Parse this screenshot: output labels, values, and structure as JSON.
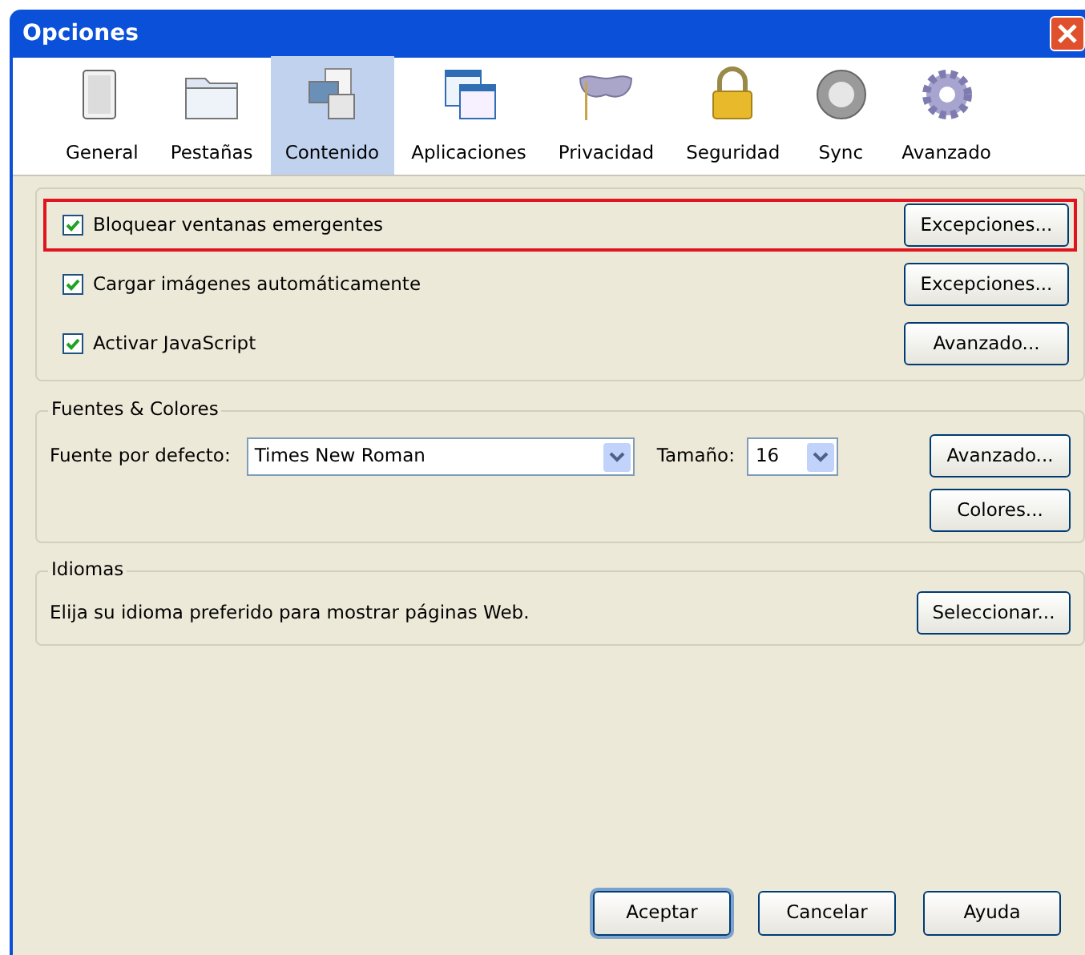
{
  "window": {
    "title": "Opciones"
  },
  "tabs": [
    {
      "label": "General",
      "selected": false,
      "kind": "general"
    },
    {
      "label": "Pestañas",
      "selected": false,
      "kind": "tabs"
    },
    {
      "label": "Contenido",
      "selected": true,
      "kind": "content"
    },
    {
      "label": "Aplicaciones",
      "selected": false,
      "kind": "apps"
    },
    {
      "label": "Privacidad",
      "selected": false,
      "kind": "privacy"
    },
    {
      "label": "Seguridad",
      "selected": false,
      "kind": "security"
    },
    {
      "label": "Sync",
      "selected": false,
      "kind": "sync"
    },
    {
      "label": "Avanzado",
      "selected": false,
      "kind": "advanced"
    }
  ],
  "content_options": [
    {
      "label": "Bloquear ventanas emergentes",
      "checked": true,
      "highlighted": true,
      "button": "Excepciones..."
    },
    {
      "label": "Cargar imágenes automáticamente",
      "checked": true,
      "highlighted": false,
      "button": "Excepciones..."
    },
    {
      "label": "Activar JavaScript",
      "checked": true,
      "highlighted": false,
      "button": "Avanzado..."
    }
  ],
  "fonts_colors": {
    "title": "Fuentes & Colores",
    "font_label": "Fuente por defecto:",
    "font_value": "Times New Roman",
    "size_label": "Tamaño:",
    "size_value": "16",
    "advanced_button": "Avanzado...",
    "colors_button": "Colores..."
  },
  "languages": {
    "title": "Idiomas",
    "description": "Elija su idioma preferido para mostrar páginas Web.",
    "button": "Seleccionar..."
  },
  "buttons": [
    {
      "label": "Aceptar",
      "kind": "default"
    },
    {
      "label": "Cancelar",
      "kind": "normal"
    },
    {
      "label": "Ayuda",
      "kind": "normal"
    }
  ]
}
